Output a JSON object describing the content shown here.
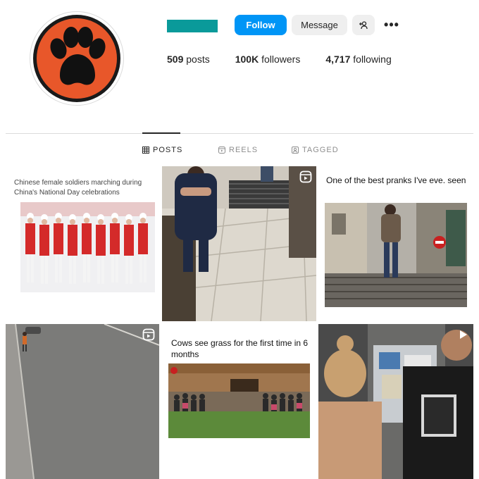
{
  "profile": {
    "avatar_icon": "paw-print-icon",
    "avatar_colors": {
      "ring": "#1a1a1a",
      "fill": "#e8572a",
      "paw": "#111111"
    },
    "username_color": "#0a9a9a"
  },
  "actions": {
    "follow_label": "Follow",
    "message_label": "Message",
    "add_user_icon": "add-user-icon",
    "more_label": "•••"
  },
  "stats": {
    "posts_count": "509",
    "posts_label": "posts",
    "followers_count": "100K",
    "followers_label": "followers",
    "following_count": "4,717",
    "following_label": "following"
  },
  "tabs": [
    {
      "label": "POSTS",
      "icon": "grid-icon",
      "active": true
    },
    {
      "label": "REELS",
      "icon": "reels-icon",
      "active": false
    },
    {
      "label": "TAGGED",
      "icon": "tagged-icon",
      "active": false
    }
  ],
  "posts": [
    {
      "caption": "Chinese female soldiers marching during China's National Day celebrations",
      "reel": false
    },
    {
      "caption": "",
      "reel": true
    },
    {
      "caption": "One of the best pranks I've eve. seen",
      "reel": false
    },
    {
      "caption": "",
      "reel": true
    },
    {
      "caption": "Cows see grass for the first time in 6 months",
      "reel": false
    },
    {
      "caption": "",
      "reel": true
    }
  ],
  "colors": {
    "accent": "#0095f6",
    "border": "#dbdbdb",
    "muted": "#8e8e8e"
  }
}
